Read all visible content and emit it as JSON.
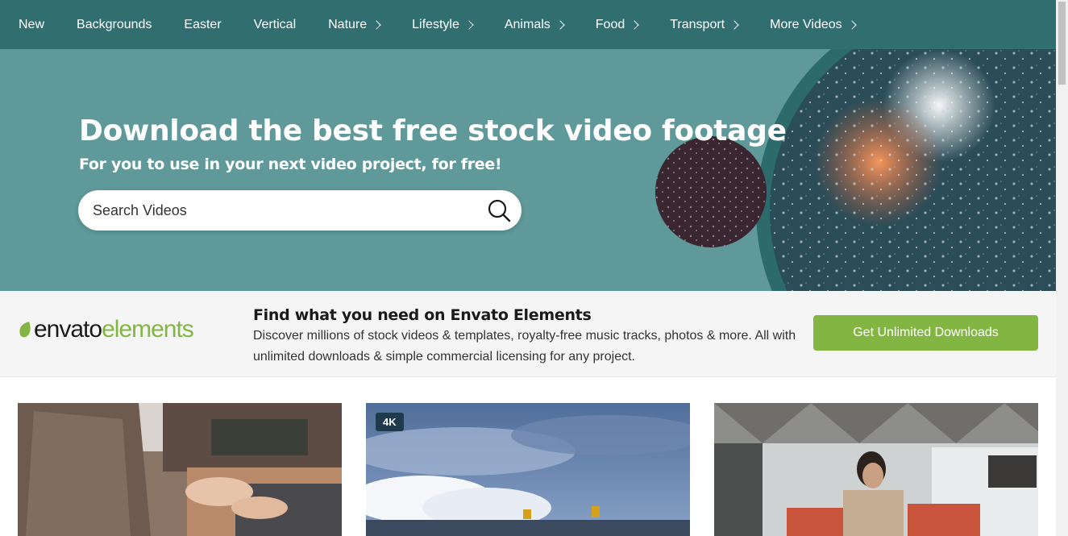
{
  "nav": {
    "items": [
      {
        "label": "New",
        "has_chevron": false
      },
      {
        "label": "Backgrounds",
        "has_chevron": false
      },
      {
        "label": "Easter",
        "has_chevron": false
      },
      {
        "label": "Vertical",
        "has_chevron": false
      },
      {
        "label": "Nature",
        "has_chevron": true
      },
      {
        "label": "Lifestyle",
        "has_chevron": true
      },
      {
        "label": "Animals",
        "has_chevron": true
      },
      {
        "label": "Food",
        "has_chevron": true
      },
      {
        "label": "Transport",
        "has_chevron": true
      },
      {
        "label": "More Videos",
        "has_chevron": true
      }
    ]
  },
  "hero": {
    "title": "Download the best free stock video footage",
    "subtitle": "For you to use in your next video project, for free!",
    "search_placeholder": "Search Videos"
  },
  "promo": {
    "logo_text_dark": "envato",
    "logo_text_green": "elements",
    "title": "Find what you need on Envato Elements",
    "description": "Discover millions of stock videos & templates, royalty-free music tracks, photos & more. All with unlimited downloads & simple commercial licensing for any project.",
    "cta_label": "Get Unlimited Downloads"
  },
  "cards": [
    {
      "badge": "",
      "subject": "hands typing on laptop"
    },
    {
      "badge": "4K",
      "subject": "cloudy sky over road"
    },
    {
      "badge": "",
      "subject": "woman on phone in office"
    }
  ],
  "colors": {
    "nav_bg": "#306e70",
    "hero_bg": "#5f9999",
    "accent_green": "#82b541"
  }
}
